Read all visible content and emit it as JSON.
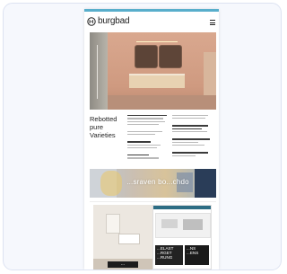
{
  "brand": {
    "name": "burgbad",
    "logo_icon": "burgbad-logo-icon"
  },
  "header": {
    "menu_icon": "hamburger-menu-icon"
  },
  "hero": {
    "title_lines": [
      "Rebotted",
      "pure",
      "Varieties"
    ]
  },
  "banner": {
    "text": "...sraven bo...chdo"
  },
  "promo_left": {
    "caption": "..."
  },
  "promo_right": {
    "text_block_1": "...ELAST ...RGET ...RUNG",
    "text_block_2": "...NS ...ENS"
  }
}
